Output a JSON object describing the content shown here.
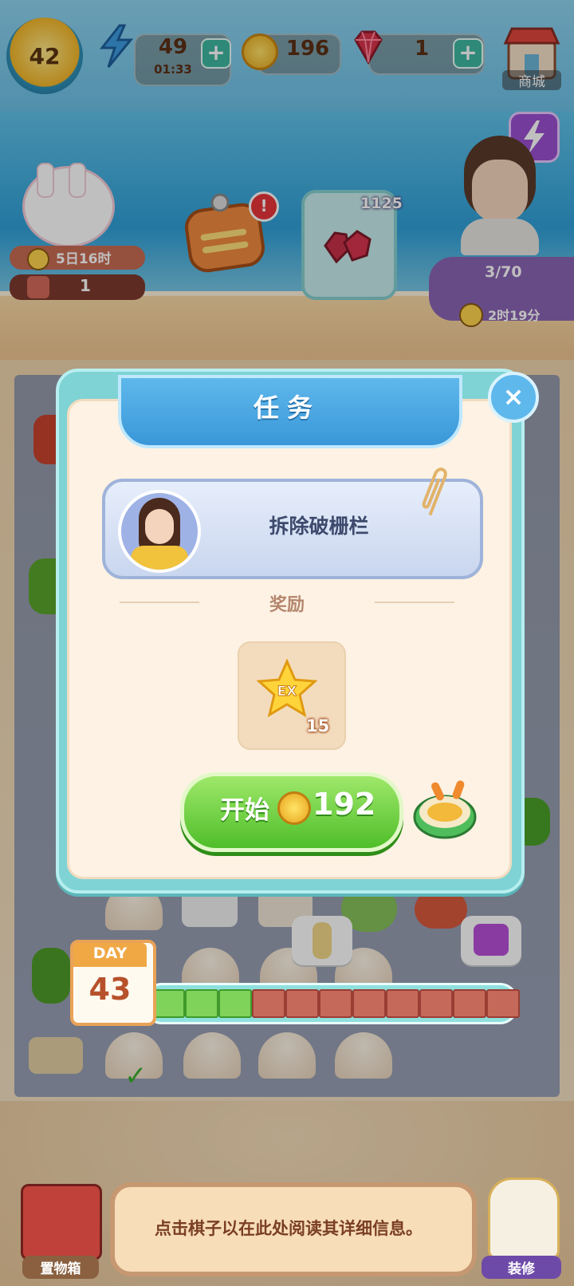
{
  "top_bar": {
    "level": "42",
    "energy": {
      "value": "49",
      "timer": "01:33"
    },
    "coins": "196",
    "gems": "1",
    "plus_symbol": "+",
    "shop_label": "商城"
  },
  "event": {
    "countdown": "5日16时",
    "count": "1"
  },
  "gem_card_count": "1125",
  "alert_mark": "!",
  "quest_panel": {
    "progress": "3/70",
    "timer": "2时19分"
  },
  "modal": {
    "title": "任务",
    "close_symbol": "×",
    "task_name": "拆除破栅栏",
    "reward_label": "奖励",
    "reward": {
      "badge": "EX",
      "count": "15"
    },
    "start_label": "开始",
    "start_price": "192"
  },
  "day": {
    "label": "DAY",
    "number": "43"
  },
  "progress": {
    "filled": 3,
    "total": 11
  },
  "hint": "点击棋子以在此处阅读其详细信息。",
  "storage_label": "置物箱",
  "decorate_label": "装修",
  "colors": {
    "accent_teal": "#7fd3d4",
    "header_blue": "#3a97d8",
    "start_green": "#4fbe2a",
    "progress_filled": "#7fd25a",
    "progress_empty": "#c56a5a"
  }
}
